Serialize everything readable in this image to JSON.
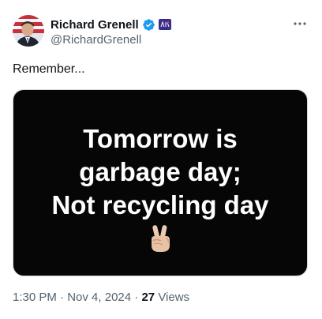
{
  "author": {
    "display_name": "Richard Grenell",
    "handle": "@RichardGrenell",
    "verified": true
  },
  "tweet": {
    "text": "Remember..."
  },
  "media": {
    "lines": [
      "Tomorrow is",
      "garbage day;",
      "Not recycling day"
    ],
    "emoji": "victory-hand-icon"
  },
  "meta": {
    "time": "1:30 PM",
    "separator": "·",
    "date": "Nov 4, 2024",
    "views_count": "27",
    "views_label": "Views"
  },
  "colors": {
    "verified_blue": "#1d9bf0",
    "secondary_text": "#536471",
    "media_background": "#060606"
  }
}
